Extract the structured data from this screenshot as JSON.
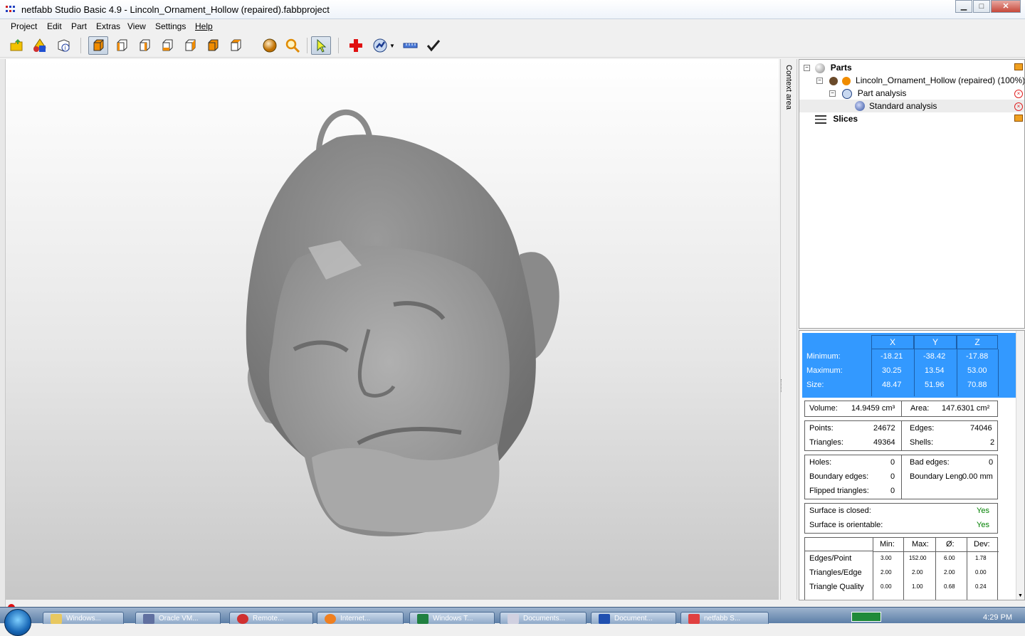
{
  "window": {
    "title": "netfabb Studio Basic 4.9 - Lincoln_Ornament_Hollow (repaired).fabbproject",
    "minimize": "▁",
    "maximize": "□",
    "close": "✕"
  },
  "menu": [
    "Project",
    "Edit",
    "Part",
    "Extras",
    "View",
    "Settings",
    "Help"
  ],
  "toolbar_icons": [
    "open-project-icon",
    "add-part-icon",
    "part-info-icon",
    "view-3d-icon",
    "view-front-icon",
    "view-back-icon",
    "view-left-icon",
    "view-right-icon",
    "view-top-icon",
    "view-bottom-icon",
    "shading-sphere-icon",
    "zoom-icon",
    "select-cursor-icon",
    "repair-cross-icon",
    "analysis-icon",
    "measure-ruler-icon",
    "apply-check-icon"
  ],
  "context_area_label": "Context area",
  "tree": {
    "parts": "Parts",
    "part_name": "Lincoln_Ornament_Hollow (repaired) (100%)",
    "part_analysis": "Part analysis",
    "standard_analysis": "Standard analysis",
    "slices": "Slices"
  },
  "props": {
    "axes": [
      "X",
      "Y",
      "Z"
    ],
    "rows": [
      {
        "label": "Minimum:",
        "x": "-18.21",
        "y": "-38.42",
        "z": "-17.88"
      },
      {
        "label": "Maximum:",
        "x": "30.25",
        "y": "13.54",
        "z": "53.00"
      },
      {
        "label": "Size:",
        "x": "48.47",
        "y": "51.96",
        "z": "70.88"
      }
    ],
    "volume_label": "Volume:",
    "volume_value": "14.9459 cm³",
    "area_label": "Area:",
    "area_value": "147.6301 cm²",
    "points_label": "Points:",
    "points_value": "24672",
    "edges_label": "Edges:",
    "edges_value": "74046",
    "triangles_label": "Triangles:",
    "triangles_value": "49364",
    "shells_label": "Shells:",
    "shells_value": "2",
    "holes_label": "Holes:",
    "holes_value": "0",
    "bad_edges_label": "Bad edges:",
    "bad_edges_value": "0",
    "boundary_edges_label": "Boundary edges:",
    "boundary_edges_value": "0",
    "boundary_length_label": "Boundary Leng",
    "boundary_length_value": "0.00 mm",
    "flipped_label": "Flipped triangles:",
    "flipped_value": "0",
    "closed_label": "Surface is closed:",
    "closed_value": "Yes",
    "orientable_label": "Surface is orientable:",
    "orientable_value": "Yes",
    "stats_headers": [
      "Min:",
      "Max:",
      "Ø:",
      "Dev:"
    ],
    "stats_rows": [
      {
        "label": "Edges/Point",
        "min": "3.00",
        "max": "152.00",
        "avg": "6.00",
        "dev": "1.78"
      },
      {
        "label": "Triangles/Edge",
        "min": "2.00",
        "max": "2.00",
        "avg": "2.00",
        "dev": "0.00"
      },
      {
        "label": "Triangle Quality",
        "min": "0.00",
        "max": "1.00",
        "avg": "0.68",
        "dev": "0.24"
      }
    ]
  },
  "taskbar": {
    "items": [
      "Windows...",
      "Oracle VM...",
      "Remote...",
      "Internet...",
      "Windows T...",
      "Documents...",
      "Document...",
      "netfabb S..."
    ],
    "clock": "4:29 PM"
  },
  "colors": {
    "accent_blue": "#3399ff",
    "yes_green": "#008000",
    "model_gray": "#8c8c8c"
  }
}
